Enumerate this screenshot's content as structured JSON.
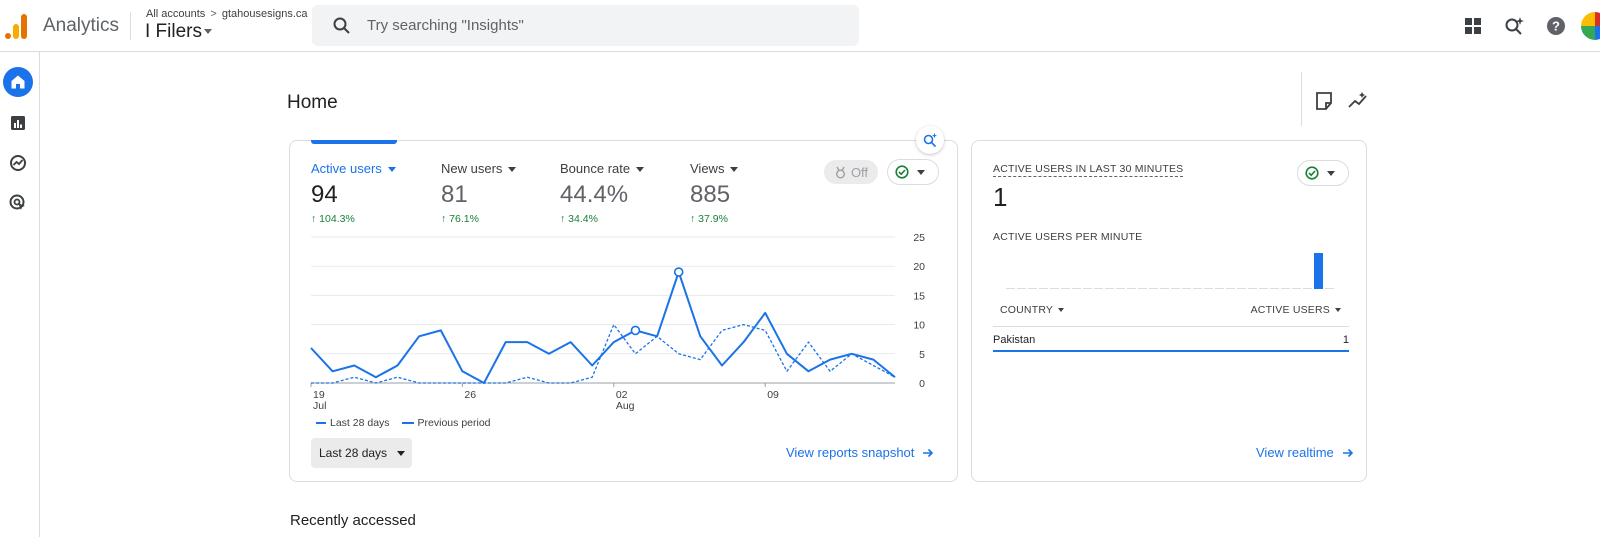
{
  "header": {
    "app_name": "Analytics",
    "breadcrumb": {
      "accounts": "All accounts",
      "separator": ">",
      "account": "gtahousesigns.ca"
    },
    "property": "I Filers",
    "search_placeholder": "Try searching \"Insights\"",
    "icons": [
      "apps-grid-icon",
      "search-insights-icon",
      "help-icon",
      "account-avatar"
    ]
  },
  "nav": {
    "items": [
      "home-icon",
      "reports-icon",
      "explore-icon",
      "advertising-icon"
    ],
    "active": "home-icon"
  },
  "page": {
    "title": "Home",
    "icons": [
      "annotation-icon",
      "insights-trend-icon"
    ]
  },
  "overview": {
    "metrics": [
      {
        "label": "Active users",
        "value": "94",
        "change": "104.3%"
      },
      {
        "label": "New users",
        "value": "81",
        "change": "76.1%"
      },
      {
        "label": "Bounce rate",
        "value": "44.4%",
        "change": "34.4%"
      },
      {
        "label": "Views",
        "value": "885",
        "change": "37.9%"
      }
    ],
    "comparison_toggle": "Off",
    "legend": {
      "current": "Last 28 days",
      "previous": "Previous period"
    },
    "date_range": "Last 28 days",
    "snapshot_link": "View reports snapshot"
  },
  "chart_data": {
    "type": "line",
    "x_tick_labels": [
      {
        "day": "19",
        "month": "Jul"
      },
      {
        "day": "26",
        "month": ""
      },
      {
        "day": "02",
        "month": "Aug"
      },
      {
        "day": "09",
        "month": ""
      }
    ],
    "y_ticks": [
      0,
      5,
      10,
      15,
      20,
      25
    ],
    "ylim": [
      0,
      25
    ],
    "series": [
      {
        "name": "Last 28 days",
        "style": "solid",
        "values": [
          6,
          2,
          3,
          1,
          3,
          8,
          9,
          2,
          0,
          7,
          7,
          5,
          7,
          3,
          7,
          9,
          8,
          19,
          8,
          3,
          7,
          12,
          5,
          2,
          4,
          5,
          4,
          1
        ]
      },
      {
        "name": "Previous period",
        "style": "dashed",
        "values": [
          0,
          0,
          1,
          0,
          1,
          0,
          0,
          0,
          0,
          0,
          1,
          0,
          0,
          1,
          10,
          5,
          8,
          5,
          4,
          9,
          10,
          9,
          2,
          7,
          2,
          5,
          3,
          1
        ]
      }
    ],
    "highlighted_points": [
      15,
      17
    ],
    "grid": true,
    "color": "#1a73e8"
  },
  "realtime": {
    "title": "ACTIVE USERS IN LAST 30 MINUTES",
    "count": "1",
    "per_minute_label": "ACTIVE USERS PER MINUTE",
    "per_minute": [
      0,
      0,
      0,
      0,
      0,
      0,
      0,
      0,
      0,
      0,
      0,
      0,
      0,
      0,
      0,
      0,
      0,
      0,
      0,
      0,
      0,
      0,
      0,
      0,
      0,
      0,
      0,
      0,
      1,
      0
    ],
    "columns": {
      "country": "COUNTRY",
      "users": "ACTIVE USERS"
    },
    "rows": [
      {
        "country": "Pakistan",
        "users": "1"
      }
    ],
    "link": "View realtime"
  },
  "recent": {
    "title": "Recently accessed"
  },
  "colors": {
    "accent": "#1a73e8",
    "positive": "#188038",
    "logo_orange": "#f9ab00",
    "logo_dark": "#e37400"
  }
}
